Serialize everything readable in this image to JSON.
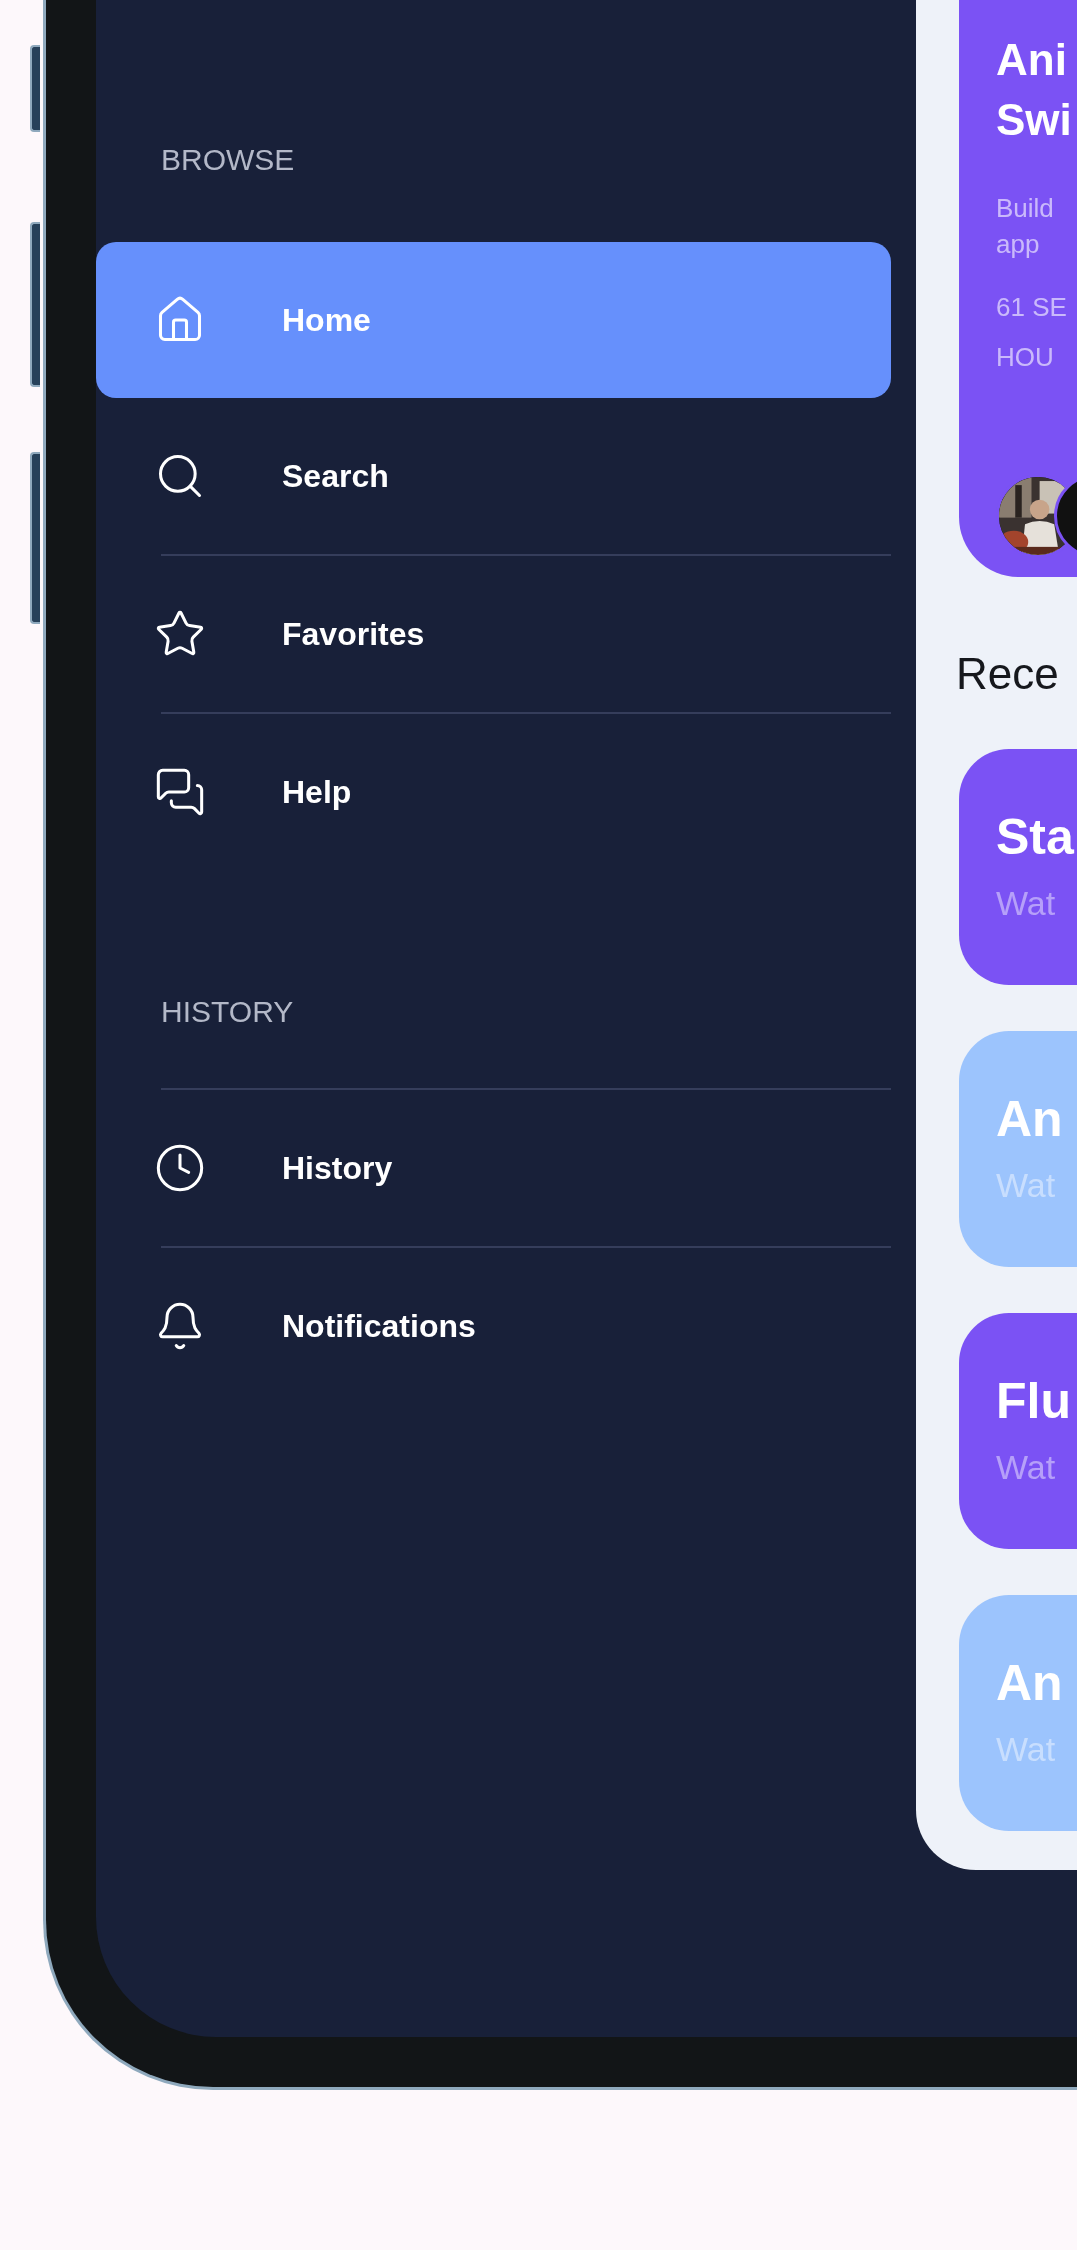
{
  "sidebar": {
    "sections": [
      {
        "heading": "BROWSE",
        "items": [
          {
            "label": "Home",
            "selected": true
          },
          {
            "label": "Search",
            "selected": false
          },
          {
            "label": "Favorites",
            "selected": false
          },
          {
            "label": "Help",
            "selected": false
          }
        ]
      },
      {
        "heading": "HISTORY",
        "items": [
          {
            "label": "History",
            "selected": false
          },
          {
            "label": "Notifications",
            "selected": false
          }
        ]
      }
    ]
  },
  "featured_card": {
    "title_lines": [
      "Ani",
      "Swi"
    ],
    "description_lines": [
      "Build",
      "app"
    ],
    "meta_lines": [
      "61 SE",
      "HOU"
    ]
  },
  "recent": {
    "title": "Rece",
    "items": [
      {
        "title": "Sta",
        "subtitle": "Wat",
        "color": "#7b52f4"
      },
      {
        "title": "An",
        "subtitle": "Wat",
        "color": "#9cc4fd"
      },
      {
        "title": "Flu",
        "subtitle": "Wat",
        "color": "#7b52f4"
      },
      {
        "title": "An",
        "subtitle": "Wat",
        "color": "#9cc4fd"
      }
    ]
  }
}
